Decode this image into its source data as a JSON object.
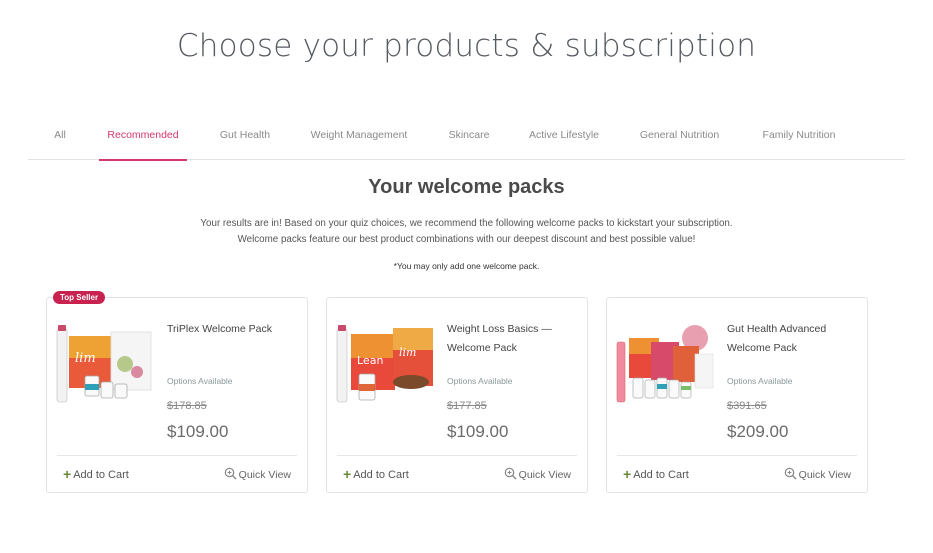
{
  "page": {
    "title": "Choose your products & subscription"
  },
  "tabs": [
    {
      "label": "All"
    },
    {
      "label": "Recommended"
    },
    {
      "label": "Gut Health"
    },
    {
      "label": "Weight Management"
    },
    {
      "label": "Skincare"
    },
    {
      "label": "Active Lifestyle"
    },
    {
      "label": "General Nutrition"
    },
    {
      "label": "Family Nutrition"
    }
  ],
  "active_tab": "Recommended",
  "section": {
    "title": "Your welcome packs",
    "desc_line1": "Your results are in! Based on your quiz choices, we recommend the following welcome packs to kickstart your subscription.",
    "desc_line2": "Welcome packs feature our best product combinations with our deepest discount and best possible value!",
    "note": "*You may only add one welcome pack."
  },
  "cards": [
    {
      "badge": "Top Seller",
      "name": "TriPlex Welcome Pack",
      "options": "Options Available",
      "old_price": "$178.85",
      "price": "$109.00",
      "add_label": "Add to Cart",
      "quick_label": "Quick View"
    },
    {
      "name": "Weight Loss Basics — Welcome Pack",
      "options": "Options Available",
      "old_price": "$177.85",
      "price": "$109.00",
      "add_label": "Add to Cart",
      "quick_label": "Quick View"
    },
    {
      "name": "Gut Health Advanced Welcome Pack",
      "options": "Options Available",
      "old_price": "$391.65",
      "price": "$209.00",
      "add_label": "Add to Cart",
      "quick_label": "Quick View"
    }
  ],
  "colors": {
    "accent": "#d2386a",
    "badge": "#c8224f",
    "plus": "#6a8a3a"
  }
}
